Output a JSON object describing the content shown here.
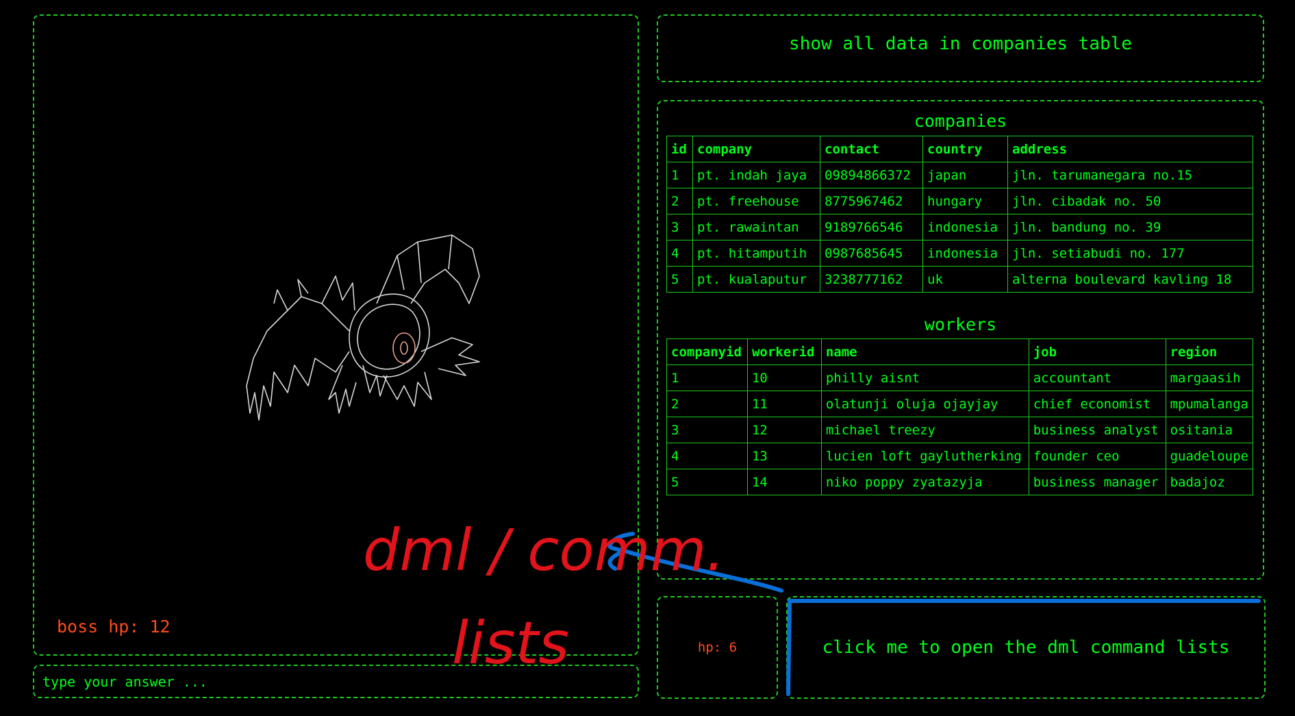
{
  "boss": {
    "hp_label": "boss hp: 12"
  },
  "answer": {
    "placeholder": "type your answer ..."
  },
  "question": {
    "text": "show all data in companies table"
  },
  "companies": {
    "title": "companies",
    "columns": [
      "id",
      "company",
      "contact",
      "country",
      "address"
    ],
    "rows": [
      [
        "1",
        "pt. indah jaya",
        "09894866372",
        "japan",
        "jln. tarumanegara no.15"
      ],
      [
        "2",
        "pt. freehouse",
        "8775967462",
        "hungary",
        "jln. cibadak no. 50"
      ],
      [
        "3",
        "pt. rawaintan",
        "9189766546",
        "indonesia",
        "jln. bandung no. 39"
      ],
      [
        "4",
        "pt. hitamputih",
        "0987685645",
        "indonesia",
        "jln. setiabudi no. 177"
      ],
      [
        "5",
        "pt. kualaputur",
        "3238777162",
        "uk",
        "alterna boulevard kavling 18"
      ]
    ]
  },
  "workers": {
    "title": "workers",
    "columns": [
      "companyid",
      "workerid",
      "name",
      "job",
      "region"
    ],
    "rows": [
      [
        "1",
        "10",
        "philly aisnt",
        "accountant",
        "margaasih"
      ],
      [
        "2",
        "11",
        "olatunji oluja ojayjay",
        "chief economist",
        "mpumalanga"
      ],
      [
        "3",
        "12",
        "michael treezy",
        "business analyst",
        "ositania"
      ],
      [
        "4",
        "13",
        "lucien loft gaylutherking",
        "founder ceo",
        "guadeloupe"
      ],
      [
        "5",
        "14",
        "niko poppy zyatazyja",
        "business manager",
        "badajoz"
      ]
    ]
  },
  "player": {
    "hp_label": "hp: 6"
  },
  "dml_button": {
    "label": "click me to open the dml command lists"
  },
  "annotation": {
    "line1": "dml / comm.",
    "line2": "lists"
  },
  "colors": {
    "terminal_green": "#00ff1a",
    "border_green": "#1ecc1e",
    "hp_orange": "#ff4a1c",
    "annotation_red": "#e3131b",
    "annotation_blue": "#0a6fd8",
    "background": "#000000"
  }
}
